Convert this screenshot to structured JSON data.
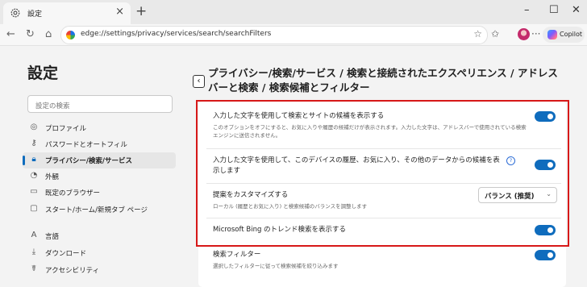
{
  "browser": {
    "tab_title": "設定",
    "url": "edge://settings/privacy/services/search/searchFilters",
    "copilot_label": "Copilot"
  },
  "sidebar": {
    "title": "設定",
    "search_placeholder": "設定の検索",
    "items": [
      {
        "label": "プロファイル",
        "icon": "profile-icon"
      },
      {
        "label": "パスワードとオートフィル",
        "icon": "key-icon"
      },
      {
        "label": "プライバシー/検索/サービス",
        "icon": "lock-icon",
        "active": true
      },
      {
        "label": "外観",
        "icon": "appearance-icon"
      },
      {
        "label": "既定のブラウザー",
        "icon": "browser-icon"
      },
      {
        "label": "スタート/ホーム/新規タブ ページ",
        "icon": "home-icon"
      },
      {
        "label": "言語",
        "icon": "language-icon"
      },
      {
        "label": "ダウンロード",
        "icon": "download-icon"
      },
      {
        "label": "アクセシビリティ",
        "icon": "accessibility-icon"
      }
    ]
  },
  "main": {
    "title": "プライバシー/検索/サービス / 検索と接続されたエクスペリエンス / アドレス バーと検索 / 検索候補とフィルター",
    "settings": [
      {
        "title": "入力した文字を使用して検索とサイトの候補を表示する",
        "desc": "このオプションをオフにすると、お気に入りや履歴の候補だけが表示されます。入力した文字は、アドレスバーで使用されている検索エンジンに送信されません。",
        "enabled": true
      },
      {
        "title": "入力した文字を使用して、このデバイスの履歴、お気に入り、その他のデータからの候補を表示します",
        "desc": "",
        "enabled": true
      },
      {
        "title": "提案をカスタマイズする",
        "desc": "ローカル (履歴とお気に入り) と検索候補のバランスを調整します",
        "select_value": "バランス (推奨)"
      },
      {
        "title": "Microsoft Bing のトレンド検索を表示する",
        "desc": "",
        "enabled": true
      },
      {
        "title": "検索フィルター",
        "desc": "選択したフィルターに従って検索候補を絞り込みます",
        "enabled": true
      }
    ]
  },
  "colors": {
    "accent": "#0f6cbd",
    "highlight_border": "#d71818"
  }
}
